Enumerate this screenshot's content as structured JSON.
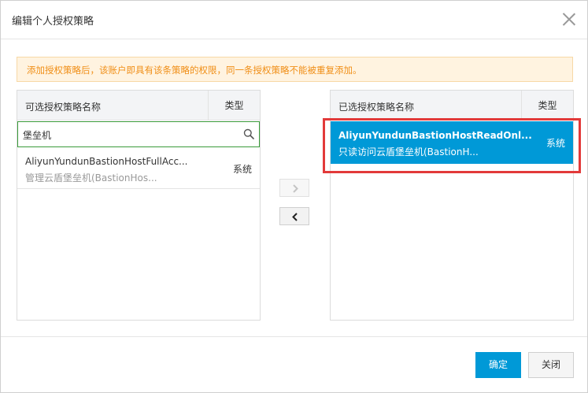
{
  "dialog": {
    "title": "编辑个人授权策略",
    "notice": "添加授权策略后，该账户即具有该条策略的权限，同一条授权策略不能被重复添加。"
  },
  "available": {
    "header_name": "可选授权策略名称",
    "header_type": "类型",
    "search_value": "堡垒机",
    "items": [
      {
        "title": "AliyunYundunBastionHostFullAcc...",
        "subtitle": "管理云盾堡垒机(BastionHos...",
        "type": "系统"
      }
    ]
  },
  "selected": {
    "header_name": "已选授权策略名称",
    "header_type": "类型",
    "items": [
      {
        "title": "AliyunYundunBastionHostReadOnl...",
        "subtitle": "只读访问云盾堡垒机(BastionH...",
        "type": "系统"
      }
    ]
  },
  "footer": {
    "ok_label": "确定",
    "close_label": "关闭"
  },
  "colors": {
    "accent": "#0099d7",
    "notice_text": "#f08f18",
    "notice_bg": "#fff3e0",
    "highlight": "#e23a3a"
  }
}
